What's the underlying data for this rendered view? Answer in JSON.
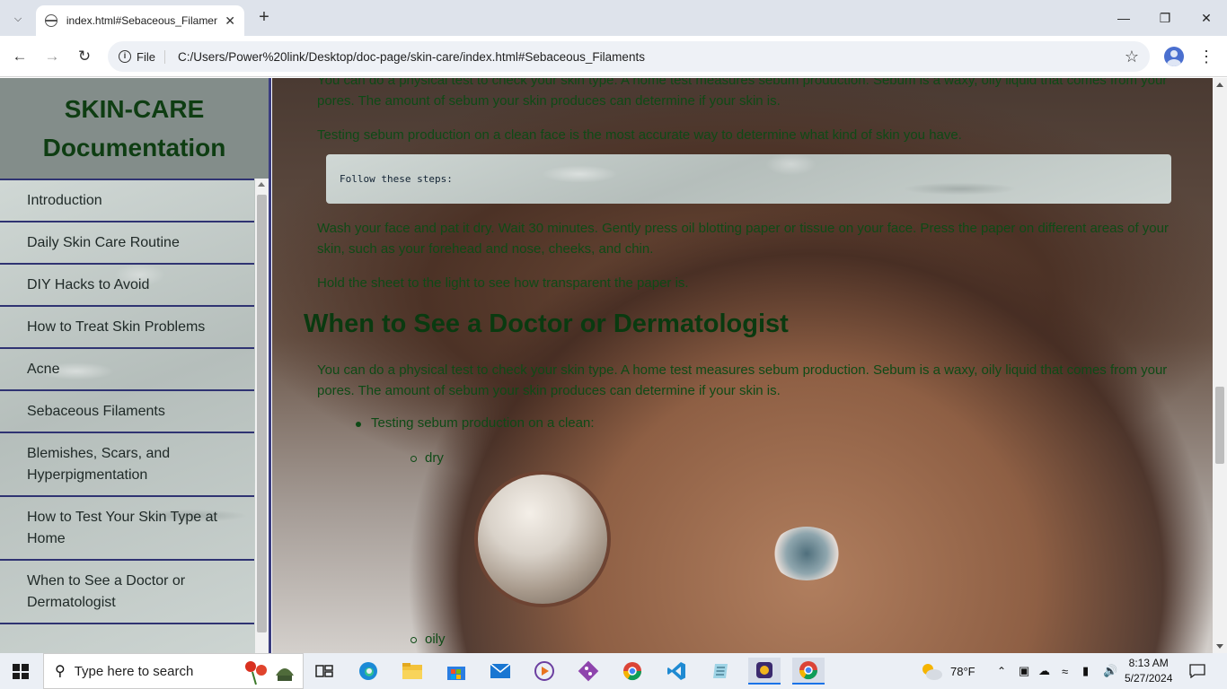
{
  "browser": {
    "tab_title": "index.html#Sebaceous_Filaments",
    "omnibox_scheme": "File",
    "url": "C:/Users/Power%20link/Desktop/doc-page/skin-care/index.html#Sebaceous_Filaments"
  },
  "sidebar": {
    "title_line1": "SKIN-CARE",
    "title_line2": "Documentation",
    "items": [
      {
        "label": "Introduction"
      },
      {
        "label": "Daily Skin Care Routine"
      },
      {
        "label": "DIY Hacks to Avoid"
      },
      {
        "label": "How to Treat Skin Problems"
      },
      {
        "label": "Acne"
      },
      {
        "label": "Sebaceous Filaments"
      },
      {
        "label": "Blemishes, Scars, and Hyperpigmentation"
      },
      {
        "label": "How to Test Your Skin Type at Home"
      },
      {
        "label": "When to See a Doctor or Dermatologist"
      }
    ]
  },
  "main": {
    "p1": "You can do a physical test to check your skin type. A home test measures sebum production. Sebum is a waxy, oily liquid that comes from your pores. The amount of sebum your skin produces can determine if your skin is.",
    "p2": "Testing sebum production on a clean face is the most accurate way to determine what kind of skin you have.",
    "code": "Follow these steps:",
    "p3": "Wash your face and pat it dry. Wait 30 minutes. Gently press oil blotting paper or tissue on your face. Press the paper on different areas of your skin, such as your forehead and nose, cheeks, and chin.",
    "p4": "Hold the sheet to the light to see how transparent the paper is.",
    "heading": "When to See a Doctor or Dermatologist",
    "p5": "You can do a physical test to check your skin type. A home test measures sebum production. Sebum is a waxy, oily liquid that comes from your pores. The amount of sebum your skin produces can determine if your skin is.",
    "bullet": "Testing sebum production on a clean:",
    "sub_bullets": [
      "dry",
      "oily"
    ]
  },
  "taskbar": {
    "search_placeholder": "Type here to search",
    "weather": "78°F",
    "time": "8:13 AM",
    "date": "5/27/2024"
  },
  "colors": {
    "heading_green": "#0a3a10",
    "sidebar_border": "#3b3d80",
    "accent_blue": "#1a73e8"
  }
}
